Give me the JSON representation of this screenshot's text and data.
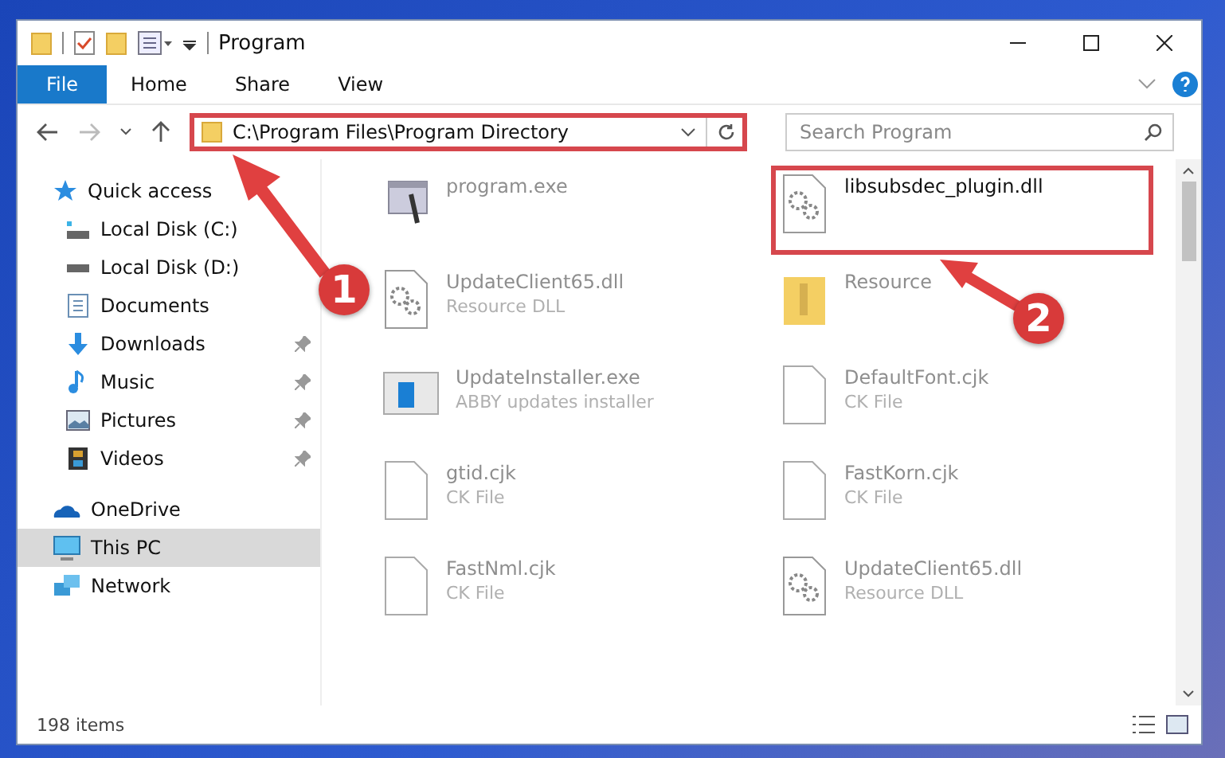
{
  "window": {
    "title": "Program"
  },
  "ribbon": {
    "tabs": [
      {
        "label": "File",
        "kind": "file",
        "selected": false
      },
      {
        "label": "Home",
        "kind": "tab",
        "selected": false
      },
      {
        "label": "Share",
        "kind": "tab",
        "selected": false
      },
      {
        "label": "View",
        "kind": "tab",
        "selected": false
      }
    ]
  },
  "address": {
    "path": "C:\\Program Files\\Program Directory",
    "highlighted": true
  },
  "search": {
    "placeholder": "Search Program"
  },
  "sidebar": {
    "items": [
      {
        "label": "Quick access",
        "kind": "star",
        "selected": false,
        "children": [
          {
            "label": "Local Disk (C:)",
            "kind": "disk-c",
            "pinned": false,
            "selected": false
          },
          {
            "label": "Local Disk (D:)",
            "kind": "disk",
            "pinned": false,
            "selected": false
          },
          {
            "label": "Documents",
            "kind": "documents",
            "pinned": false,
            "selected": false
          },
          {
            "label": "Downloads",
            "kind": "downloads",
            "pinned": true,
            "selected": false
          },
          {
            "label": "Music",
            "kind": "music",
            "pinned": true,
            "selected": false
          },
          {
            "label": "Pictures",
            "kind": "pictures",
            "pinned": true,
            "selected": false
          },
          {
            "label": "Videos",
            "kind": "videos",
            "pinned": true,
            "selected": false
          }
        ]
      },
      {
        "label": "OneDrive",
        "kind": "cloud",
        "selected": false
      },
      {
        "label": "This PC",
        "kind": "pc",
        "selected": true
      },
      {
        "label": "Network",
        "kind": "network",
        "selected": false
      }
    ]
  },
  "files": [
    {
      "name": "program.exe",
      "kind": "exe",
      "highlighted": false
    },
    {
      "name": "libsubsdec_plugin.dll",
      "kind": "dll",
      "highlighted": true
    },
    {
      "name": "UpdateClient65.dll",
      "type": "Resource DLL",
      "kind": "dll",
      "highlighted": false
    },
    {
      "name": "Resource",
      "kind": "folder",
      "highlighted": false
    },
    {
      "name": "UpdateInstaller.exe",
      "type": "ABBY updates installer",
      "kind": "installer",
      "highlighted": false
    },
    {
      "name": "DefaultFont.cjk",
      "type": "CK File",
      "kind": "file",
      "highlighted": false
    },
    {
      "name": "gtid.cjk",
      "type": "CK File",
      "kind": "file",
      "highlighted": false
    },
    {
      "name": "FastKorn.cjk",
      "type": "CK File",
      "kind": "file",
      "highlighted": false
    },
    {
      "name": "FastNml.cjk",
      "type": "CK File",
      "kind": "file",
      "highlighted": false
    },
    {
      "name": "UpdateClient65.dll",
      "type": "Resource DLL",
      "kind": "dll",
      "highlighted": false
    }
  ],
  "status_bar": {
    "count": "198 items"
  },
  "annotations": [
    {
      "label": "1"
    },
    {
      "label": "2"
    }
  ]
}
